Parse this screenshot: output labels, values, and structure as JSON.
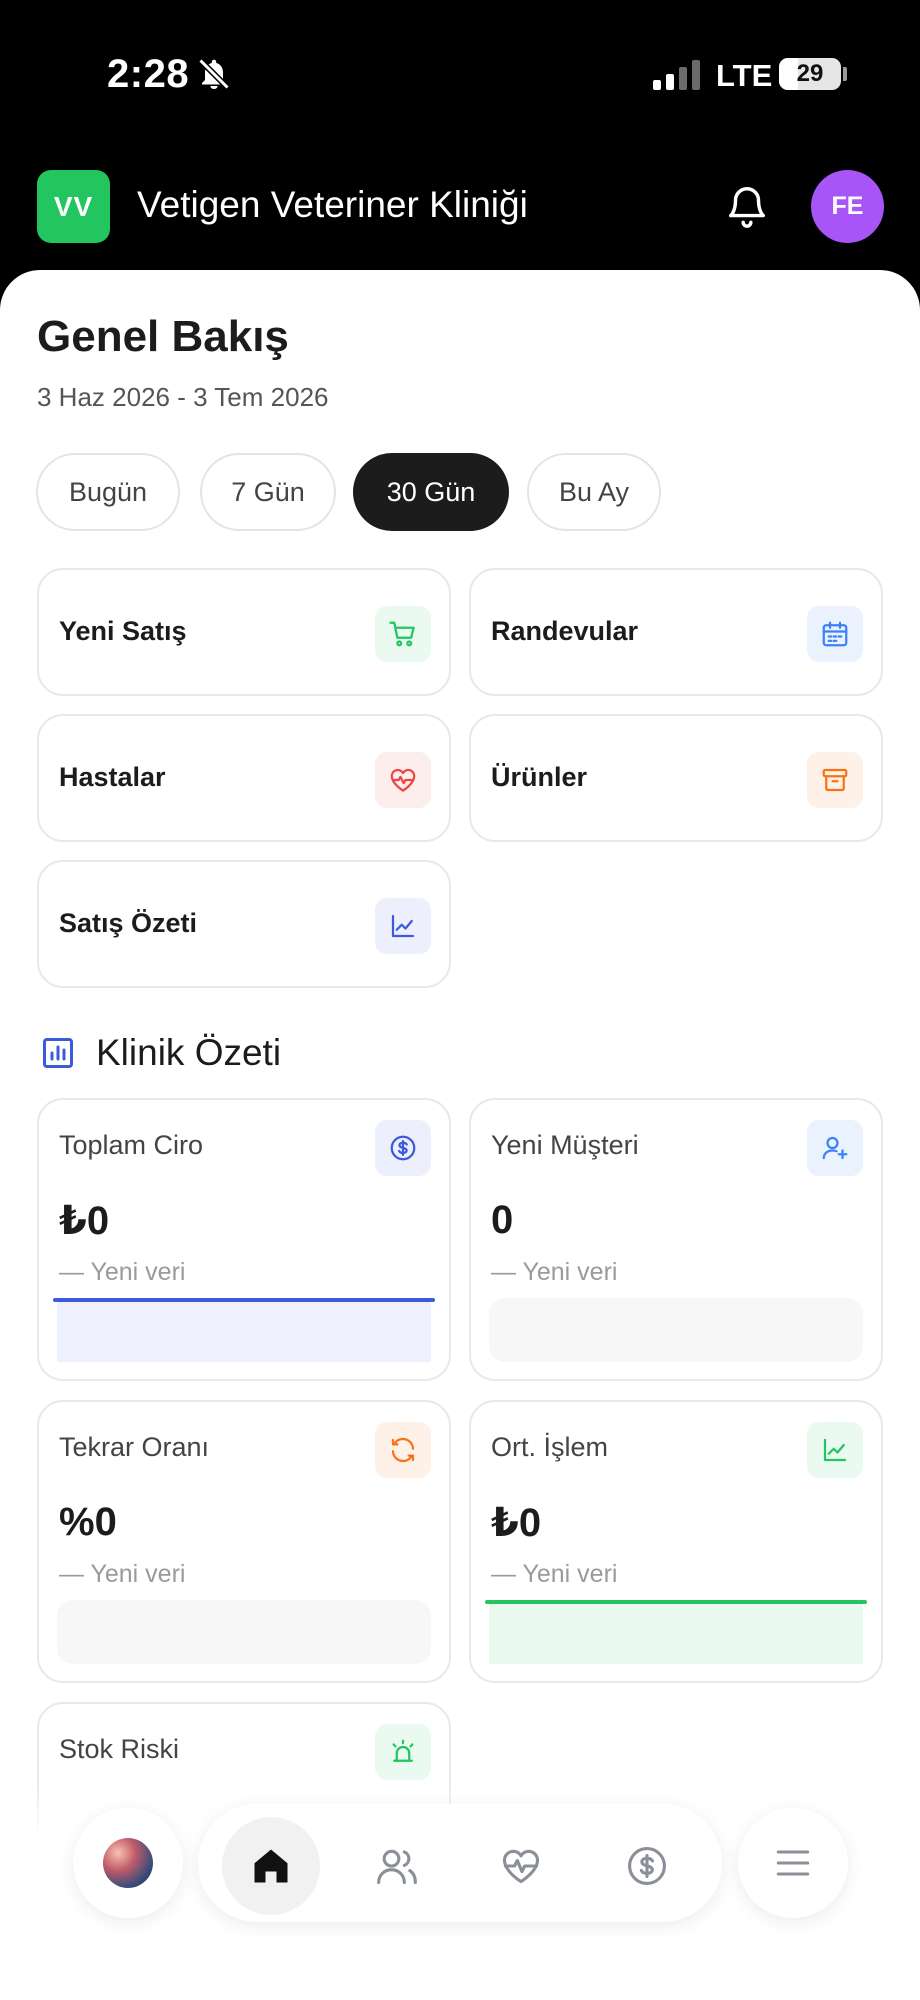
{
  "status_bar": {
    "time": "2:28",
    "network": "LTE",
    "battery": "29"
  },
  "header": {
    "logo_initials": "VV",
    "clinic_name": "Vetigen Veteriner Kliniği",
    "avatar_initials": "FE"
  },
  "overview": {
    "title": "Genel Bakış",
    "date_range": "3 Haz 2026 - 3 Tem 2026",
    "filters": [
      {
        "label": "Bugün",
        "active": false
      },
      {
        "label": "7 Gün",
        "active": false
      },
      {
        "label": "30 Gün",
        "active": true
      },
      {
        "label": "Bu Ay",
        "active": false
      }
    ]
  },
  "quick_actions": [
    {
      "label": "Yeni Satış",
      "icon": "cart-icon",
      "color": "#22c55e",
      "bg": "#eafaf0"
    },
    {
      "label": "Randevular",
      "icon": "calendar-icon",
      "color": "#3b82f6",
      "bg": "#eaf2fe"
    },
    {
      "label": "Hastalar",
      "icon": "heart-pulse-icon",
      "color": "#ef4444",
      "bg": "#fdeeee"
    },
    {
      "label": "Ürünler",
      "icon": "archive-box-icon",
      "color": "#f97316",
      "bg": "#fef2e8"
    },
    {
      "label": "Satış Özeti",
      "icon": "line-chart-icon",
      "color": "#3b5bdb",
      "bg": "#edf0fc"
    }
  ],
  "summary": {
    "title": "Klinik Özeti",
    "stats": [
      {
        "label": "Toplam Ciro",
        "value": "₺0",
        "sub": "— Yeni veri",
        "icon": "dollar-circle-icon",
        "color": "#3b5bdb",
        "bg": "#edf0fc",
        "spark": "line",
        "spark_color": "#3b5bdb",
        "spark_fill": "#eef1fd"
      },
      {
        "label": "Yeni Müşteri",
        "value": "0",
        "sub": "— Yeni veri",
        "icon": "user-plus-icon",
        "color": "#3b82f6",
        "bg": "#eaf2fe",
        "spark": "empty"
      },
      {
        "label": "Tekrar Oranı",
        "value": "%0",
        "sub": "— Yeni veri",
        "icon": "refresh-icon",
        "color": "#f97316",
        "bg": "#fef2e8",
        "spark": "empty"
      },
      {
        "label": "Ort. İşlem",
        "value": "₺0",
        "sub": "— Yeni veri",
        "icon": "trend-chart-icon",
        "color": "#22c55e",
        "bg": "#eafaf0",
        "spark": "line",
        "spark_color": "#22c55e",
        "spark_fill": "#eafaf0"
      },
      {
        "label": "Stok Riski",
        "value": "",
        "sub": "",
        "icon": "alarm-icon",
        "color": "#22c55e",
        "bg": "#eafaf0",
        "spark": "none"
      }
    ]
  },
  "bottom_nav": {
    "items": [
      {
        "name": "nav-home",
        "icon": "home-icon",
        "active": true
      },
      {
        "name": "nav-clients",
        "icon": "users-icon",
        "active": false
      },
      {
        "name": "nav-patients",
        "icon": "heart-pulse-icon",
        "active": false
      },
      {
        "name": "nav-finance",
        "icon": "dollar-circle-icon",
        "active": false
      }
    ]
  }
}
